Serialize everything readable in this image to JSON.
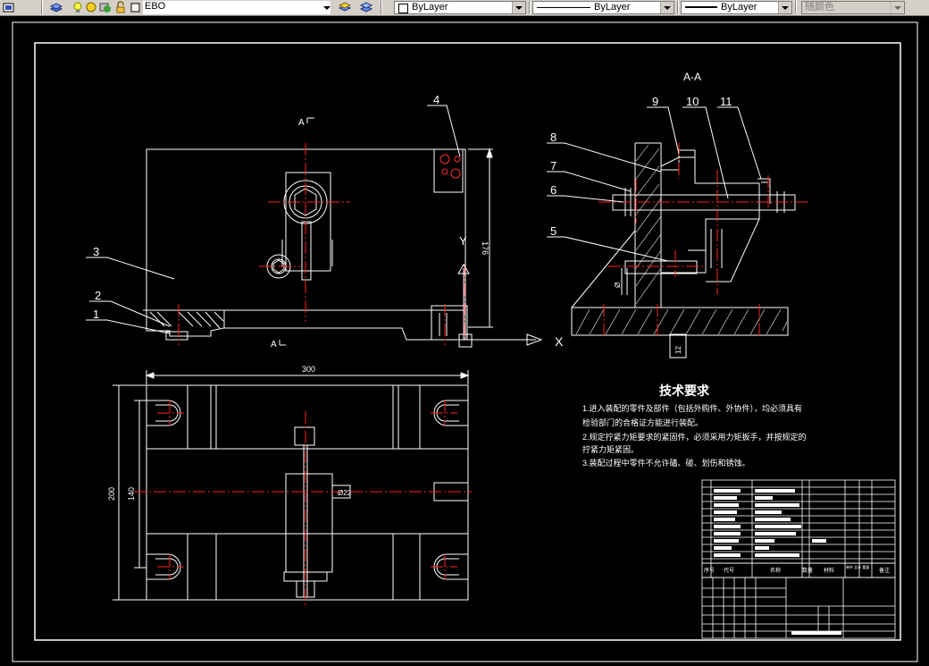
{
  "toolbar": {
    "layer_name": "EBO",
    "color": "ByLayer",
    "linetype": "ByLayer",
    "lineweight": "ByLayer",
    "plot_style": "随颜色"
  },
  "drawing": {
    "section_label": "A-A",
    "section_marker_top": "A",
    "section_marker_bottom": "A",
    "axis_x": "X",
    "axis_y": "Y",
    "balloons": [
      "1",
      "2",
      "3",
      "4",
      "5",
      "6",
      "7",
      "8",
      "9",
      "10",
      "11"
    ],
    "dim_width": "300",
    "dim_depth": "200",
    "dim_inner": "140",
    "dim_height": "176",
    "dim_hole": "Ø22",
    "dim_small": "Ø",
    "dim_side": "12",
    "tech_title": "技术要求",
    "tech_lines": [
      "1.进入装配的零件及部件（包括外购件、外协件），均必须具有",
      "检验部门的合格证方能进行装配。",
      "2.规定拧紧力矩要求的紧固件，必须采用力矩扳手，并按规定的",
      "拧紧力矩紧固。",
      "3.装配过程中零件不允许磕、碰、划伤和锈蚀。"
    ],
    "bom_header": [
      "序号",
      "代号",
      "名称",
      "数量",
      "材料",
      "单件 总计 重量",
      "备注"
    ]
  }
}
